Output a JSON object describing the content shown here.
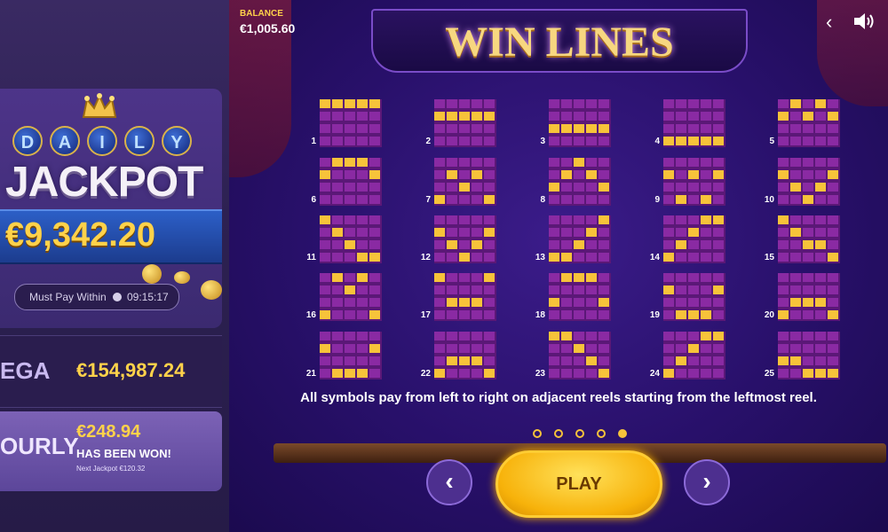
{
  "left_panel": {
    "daily_letters": [
      "D",
      "A",
      "I",
      "L",
      "Y"
    ],
    "jackpot_word": "JACKPOT",
    "jackpot_amount": "€9,342.20",
    "must_pay_label": "Must Pay Within",
    "must_pay_time": "09:15:17",
    "mega": {
      "name": "EGA",
      "value": "€154,987.24"
    },
    "hourly": {
      "name": "OURLY",
      "value": "€248.94",
      "won_text": "HAS BEEN WON!",
      "next_text": "Next Jackpot  €120.32"
    }
  },
  "header": {
    "balance_label": "BALANCE",
    "balance_value": "€1,005.60",
    "title": "WIN LINES",
    "back_icon": "chevron-left-icon",
    "sound_icon": "speaker-icon"
  },
  "win_lines": [
    {
      "num": "1",
      "rows": [
        0,
        0,
        0,
        0,
        0
      ]
    },
    {
      "num": "2",
      "rows": [
        1,
        1,
        1,
        1,
        1
      ]
    },
    {
      "num": "3",
      "rows": [
        2,
        2,
        2,
        2,
        2
      ]
    },
    {
      "num": "4",
      "rows": [
        3,
        3,
        3,
        3,
        3
      ]
    },
    {
      "num": "5",
      "rows": [
        1,
        0,
        1,
        0,
        1
      ]
    },
    {
      "num": "6",
      "rows": [
        1,
        0,
        0,
        0,
        1
      ]
    },
    {
      "num": "7",
      "rows": [
        3,
        1,
        2,
        1,
        3
      ]
    },
    {
      "num": "8",
      "rows": [
        2,
        1,
        0,
        1,
        2
      ]
    },
    {
      "num": "9",
      "rows": [
        1,
        3,
        1,
        3,
        1
      ]
    },
    {
      "num": "10",
      "rows": [
        1,
        2,
        3,
        2,
        1
      ]
    },
    {
      "num": "11",
      "rows": [
        0,
        1,
        2,
        3,
        3
      ]
    },
    {
      "num": "12",
      "rows": [
        1,
        2,
        3,
        2,
        1
      ]
    },
    {
      "num": "13",
      "rows": [
        3,
        3,
        2,
        1,
        0
      ]
    },
    {
      "num": "14",
      "rows": [
        3,
        2,
        1,
        0,
        0
      ]
    },
    {
      "num": "15",
      "rows": [
        0,
        1,
        2,
        2,
        3
      ]
    },
    {
      "num": "16",
      "rows": [
        3,
        0,
        1,
        0,
        3
      ]
    },
    {
      "num": "17",
      "rows": [
        0,
        2,
        2,
        2,
        0
      ]
    },
    {
      "num": "18",
      "rows": [
        2,
        0,
        0,
        0,
        2
      ]
    },
    {
      "num": "19",
      "rows": [
        1,
        3,
        3,
        3,
        1
      ]
    },
    {
      "num": "20",
      "rows": [
        3,
        2,
        2,
        2,
        3
      ]
    },
    {
      "num": "21",
      "rows": [
        1,
        3,
        3,
        3,
        1
      ]
    },
    {
      "num": "22",
      "rows": [
        3,
        2,
        2,
        2,
        3
      ]
    },
    {
      "num": "23",
      "rows": [
        0,
        0,
        1,
        2,
        3
      ]
    },
    {
      "num": "24",
      "rows": [
        3,
        2,
        1,
        0,
        0
      ]
    },
    {
      "num": "25",
      "rows": [
        2,
        2,
        3,
        3,
        3
      ]
    }
  ],
  "rules_text": "All symbols pay from left to right on adjacent reels starting from the leftmost reel.",
  "pagination": {
    "pages": 5,
    "current": 5
  },
  "footer": {
    "play_label": "PLAY",
    "prev_icon": "chevron-left-icon",
    "next_icon": "chevron-right-icon"
  },
  "colors": {
    "cell_on": "#f7c33a",
    "cell_off": "#8a2aa3",
    "board_bg": "#5b1877"
  }
}
